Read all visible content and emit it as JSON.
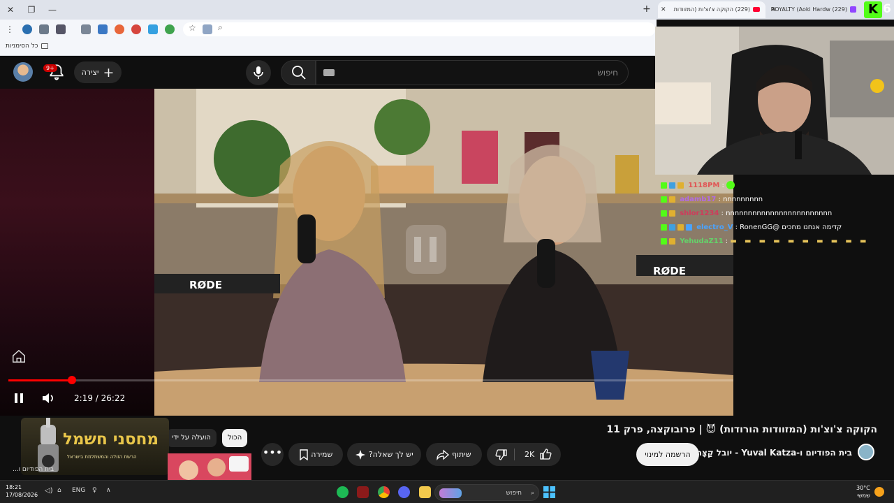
{
  "browser": {
    "tabs": [
      {
        "label": "(229) הקוקה צ'וצ'ות (המזוודות",
        "active": true,
        "icon": "youtube-icon"
      },
      {
        "label": "(229) ROYALTY (Aoki Hardw",
        "active": false,
        "icon": "twitch-icon"
      }
    ],
    "new_tab_label": "+",
    "bookmarks_label": "כל הסימניות"
  },
  "overlay": {
    "logo_letter": "K",
    "logo_number": "6",
    "chat": [
      {
        "user": "1118PM",
        "user_color": "#e05555",
        "message": "",
        "emote": true
      },
      {
        "user": "adamb17",
        "user_color": "#b06ae6",
        "message": "nnnnnnnnn"
      },
      {
        "user": "shlor1234",
        "user_color": "#d03a5b",
        "message": "nnnnnnnnnnnnnnnnnnnnnnnn"
      },
      {
        "user": "electro_V",
        "user_color": "#4aa3ff",
        "message": "קדימה אנחנו מחכים @RonenGG",
        "mention": "@RonenGG"
      },
      {
        "user": "YehudaZ11",
        "user_color": "#64d36a",
        "message": "",
        "emote_row": true
      }
    ]
  },
  "youtube": {
    "search_placeholder": "חיפוש",
    "create_label": "יצירה",
    "notifications_badge": "9+",
    "player": {
      "current_time": "2:19",
      "duration": "26:22",
      "time_display": "2:19 / 26:22",
      "progress": 0.088
    },
    "video": {
      "title": "הקוקה צ'וצ'ות (המזוודות הורודות) 😈 | פרובוקצה, פרק 11",
      "channel": "בית הפודיום ו-Yuval Katza - יובל קַצָּה",
      "subscribe_label": "הרשמה למינוי",
      "likes": "2K",
      "share_label": "שיתוף",
      "ask_label": "יש לך שאלה?",
      "save_label": "שמירה"
    },
    "chips": {
      "all": "הכול",
      "uploaded_by": "הועלה על ידי"
    },
    "sponsor": {
      "main": "מחסני חשמל",
      "sub": "הרשת הזולה והמשתלמת בישראל"
    },
    "side_item_label": "בית הפודיום ו..."
  },
  "taskbar": {
    "time": "18:21",
    "date": "17/08/2026",
    "language": "ENG",
    "search_label": "חיפוש",
    "temperature": "30°C",
    "weather": "שמשי"
  },
  "colors": {
    "youtube_red": "#ff0000",
    "kick_green": "#53fc18",
    "accent": "#f1f1f1"
  }
}
